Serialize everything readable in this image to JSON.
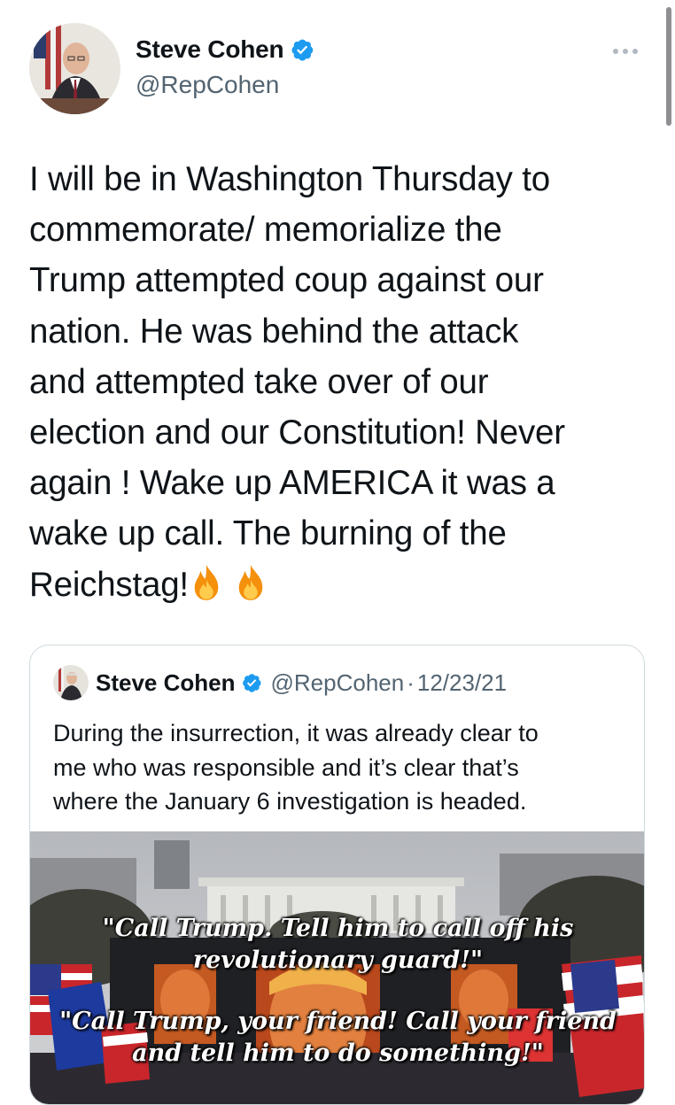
{
  "author": {
    "display_name": "Steve Cohen",
    "handle": "@RepCohen",
    "verified": true
  },
  "tweet": {
    "text": "I will be in Washington Thursday to\ncommemorate/ memorialize the\nTrump attempted coup against our\nnation. He was behind the attack\nand attempted take over of our\nelection and our Constitution! Never\nagain ! Wake up AMERICA it was a\nwake up call. The burning of the\nReichstag!",
    "emoji": [
      "fire-emoji",
      "fire-emoji"
    ]
  },
  "quoted_tweet": {
    "display_name": "Steve Cohen",
    "handle": "@RepCohen",
    "separator": "·",
    "date": "12/23/21",
    "text": "During the insurrection, it was already clear to\nme who was responsible and it’s clear that’s\nwhere the January 6 investigation is headed.",
    "image": {
      "caption_1": "\"Call Trump. Tell him to call off his\nrevolutionary guard!\"",
      "caption_2": "\"Call Trump, your friend! Call your friend\nand tell him to do something!\""
    }
  },
  "colors": {
    "verified_blue": "#1d9bf0",
    "secondary_text": "#536471",
    "border": "#cfd9de"
  },
  "icons": [
    "verified-badge-icon",
    "more-options-icon",
    "fire-emoji"
  ]
}
